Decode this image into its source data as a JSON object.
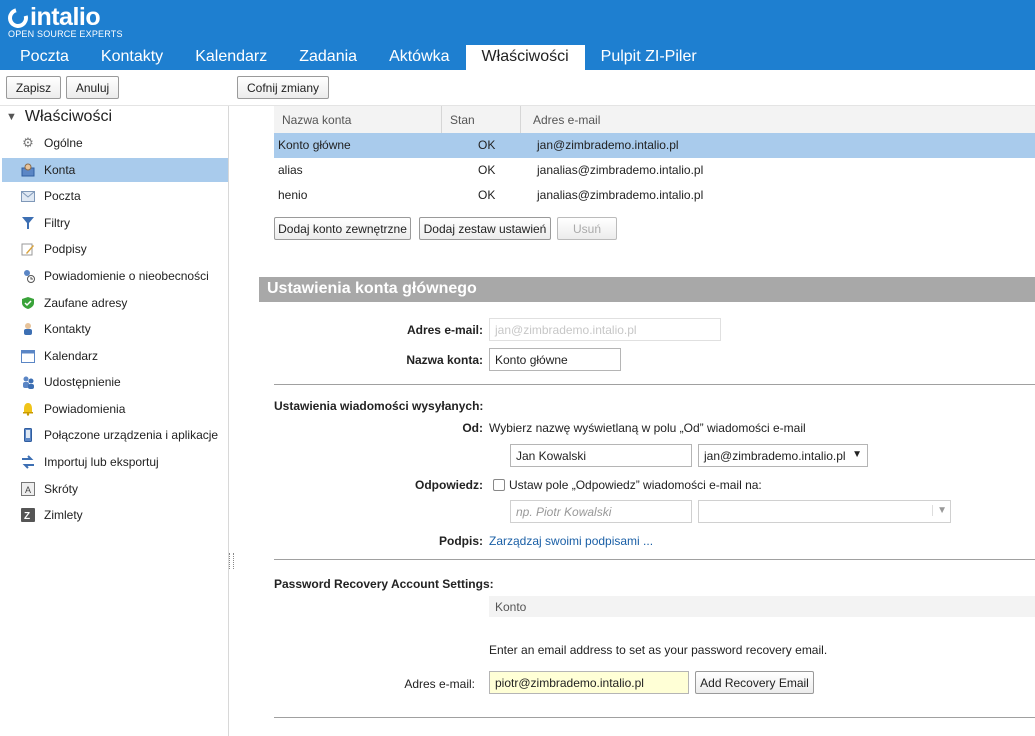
{
  "brand": {
    "name": "intalio",
    "tagline": "OPEN SOURCE EXPERTS"
  },
  "nav": {
    "tabs": [
      "Poczta",
      "Kontakty",
      "Kalendarz",
      "Zadania",
      "Aktówka",
      "Właściwości",
      "Pulpit ZI-Piler"
    ],
    "active": "Właściwości"
  },
  "toolbar": {
    "save": "Zapisz",
    "cancel": "Anuluj",
    "revert": "Cofnij zmiany"
  },
  "sidebar": {
    "root": "Właściwości",
    "items": [
      {
        "label": "Ogólne",
        "icon": "gear-icon"
      },
      {
        "label": "Konta",
        "icon": "accounts-icon"
      },
      {
        "label": "Poczta",
        "icon": "envelope-icon"
      },
      {
        "label": "Filtry",
        "icon": "filter-icon"
      },
      {
        "label": "Podpisy",
        "icon": "signature-icon"
      },
      {
        "label": "Powiadomienie o nieobecności",
        "icon": "out-of-office-icon"
      },
      {
        "label": "Zaufane adresy",
        "icon": "shield-icon"
      },
      {
        "label": "Kontakty",
        "icon": "contact-icon"
      },
      {
        "label": "Kalendarz",
        "icon": "calendar-icon"
      },
      {
        "label": "Udostępnienie",
        "icon": "sharing-icon"
      },
      {
        "label": "Powiadomienia",
        "icon": "bell-icon"
      },
      {
        "label": "Połączone urządzenia i aplikacje",
        "icon": "mobile-device-icon"
      },
      {
        "label": "Importuj lub eksportuj",
        "icon": "import-export-icon"
      },
      {
        "label": "Skróty",
        "icon": "shortcuts-icon"
      },
      {
        "label": "Zimlety",
        "icon": "zimlet-icon"
      }
    ],
    "selected": "Konta"
  },
  "accounts_table": {
    "headers": [
      "Nazwa konta",
      "Stan",
      "Adres e-mail"
    ],
    "rows": [
      {
        "name": "Konto główne",
        "status": "OK",
        "email": "jan@zimbrademo.intalio.pl"
      },
      {
        "name": "alias",
        "status": "OK",
        "email": "janalias@zimbrademo.intalio.pl"
      },
      {
        "name": "henio",
        "status": "OK",
        "email": "janalias@zimbrademo.intalio.pl"
      }
    ],
    "buttons": {
      "add_external": "Dodaj konto zewnętrzne",
      "add_persona": "Dodaj zestaw ustawień",
      "delete": "Usuń"
    }
  },
  "primary_settings": {
    "title": "Ustawienia konta głównego",
    "email_label": "Adres e-mail:",
    "email_value": "jan@zimbrademo.intalio.pl",
    "account_name_label": "Nazwa konta:",
    "account_name_value": "Konto główne"
  },
  "sending": {
    "heading": "Ustawienia wiadomości wysyłanych:",
    "from_label": "Od:",
    "from_desc": "Wybierz nazwę wyświetlaną w polu „Od” wiadomości e-mail",
    "from_name": "Jan Kowalski",
    "from_email": "jan@zimbrademo.intalio.pl",
    "reply_label": "Odpowiedz:",
    "reply_desc": "Ustaw pole „Odpowiedz” wiadomości e-mail na:",
    "reply_placeholder": "np. Piotr Kowalski",
    "signature_label": "Podpis:",
    "signature_link": "Zarządzaj swoimi podpisami ..."
  },
  "recovery": {
    "heading": "Password Recovery Account Settings:",
    "column": "Konto",
    "hint": "Enter an email address to set as your password recovery email.",
    "email_label": "Adres e-mail:",
    "email_value": "piotr@zimbrademo.intalio.pl",
    "add_button": "Add Recovery Email"
  },
  "colors": {
    "header": "#1e7fd0",
    "selected_row": "#a9cbec",
    "section_bar": "#a8a8a8",
    "link": "#1a5fa6"
  }
}
